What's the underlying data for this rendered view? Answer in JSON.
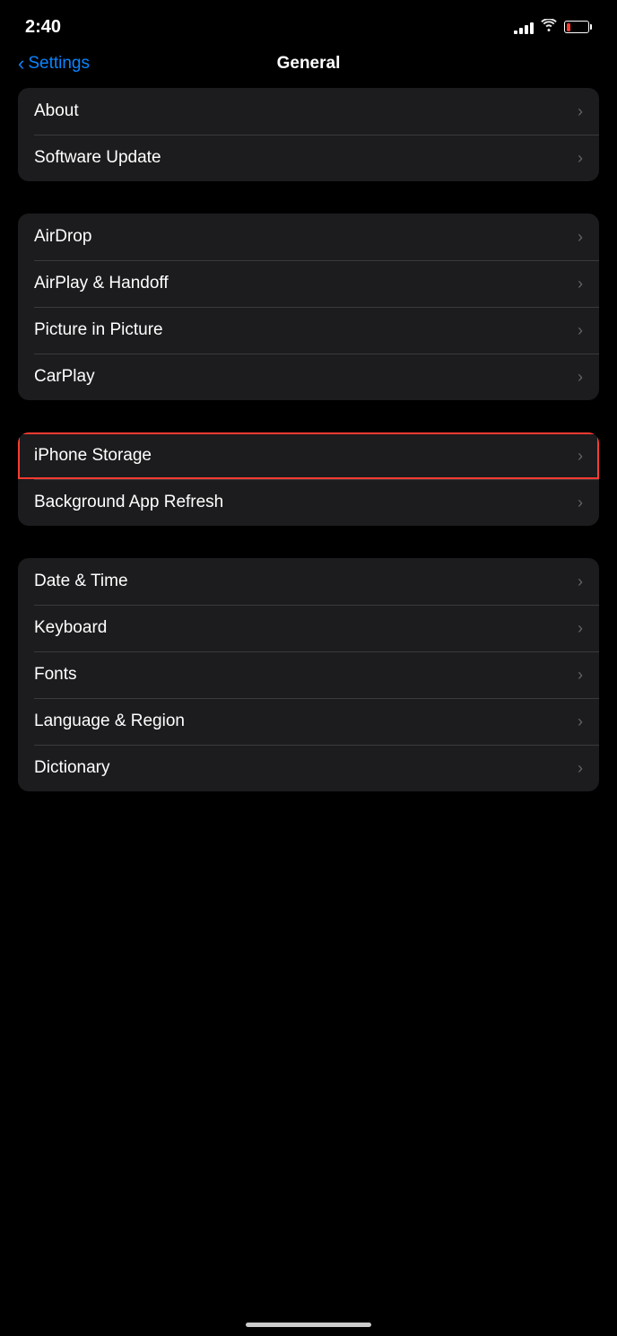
{
  "statusBar": {
    "time": "2:40",
    "batteryLow": true
  },
  "nav": {
    "backLabel": "Settings",
    "title": "General"
  },
  "sections": [
    {
      "id": "section1",
      "items": [
        {
          "id": "about",
          "label": "About",
          "highlighted": false
        },
        {
          "id": "software-update",
          "label": "Software Update",
          "highlighted": false
        }
      ]
    },
    {
      "id": "section2",
      "items": [
        {
          "id": "airdrop",
          "label": "AirDrop",
          "highlighted": false
        },
        {
          "id": "airplay-handoff",
          "label": "AirPlay & Handoff",
          "highlighted": false
        },
        {
          "id": "picture-in-picture",
          "label": "Picture in Picture",
          "highlighted": false
        },
        {
          "id": "carplay",
          "label": "CarPlay",
          "highlighted": false
        }
      ]
    },
    {
      "id": "section3",
      "items": [
        {
          "id": "iphone-storage",
          "label": "iPhone Storage",
          "highlighted": true
        },
        {
          "id": "background-app-refresh",
          "label": "Background App Refresh",
          "highlighted": false
        }
      ]
    },
    {
      "id": "section4",
      "items": [
        {
          "id": "date-time",
          "label": "Date & Time",
          "highlighted": false
        },
        {
          "id": "keyboard",
          "label": "Keyboard",
          "highlighted": false
        },
        {
          "id": "fonts",
          "label": "Fonts",
          "highlighted": false
        },
        {
          "id": "language-region",
          "label": "Language & Region",
          "highlighted": false
        },
        {
          "id": "dictionary",
          "label": "Dictionary",
          "highlighted": false
        }
      ]
    }
  ],
  "chevron": "›"
}
